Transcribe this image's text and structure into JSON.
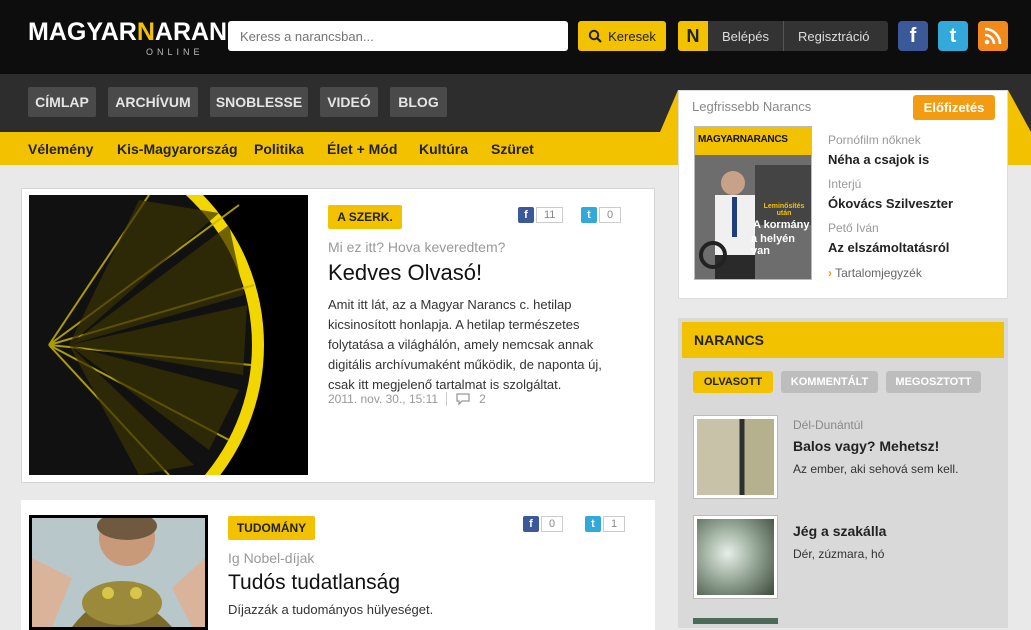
{
  "header": {
    "logo_left": "MAGYAR",
    "logo_n": "N",
    "logo_right": "ARANCS",
    "logo_sub": "ONLINE",
    "search_placeholder": "Keress a narancsban...",
    "search_button": "Keresek",
    "n_icon": "N",
    "login": "Belépés",
    "register": "Regisztráció",
    "social_icons": [
      "facebook-icon",
      "twitter-icon",
      "rss-icon"
    ]
  },
  "nav": {
    "items": [
      "CÍMLAP",
      "ARCHÍVUM",
      "SNOBLESSE",
      "VIDEÓ",
      "BLOG"
    ]
  },
  "subnav": {
    "items": [
      "Vélemény",
      "Kis-Magyarország",
      "Politika",
      "Élet + Mód",
      "Kultúra",
      "Szüret"
    ]
  },
  "articles": [
    {
      "tag": "A SZERK.",
      "fb_count": "11",
      "tw_count": "0",
      "kicker": "Mi ez itt? Hova keveredtem?",
      "title": "Kedves Olvasó!",
      "lead": "Amit itt lát, az a Magyar Narancs c. hetilap kicsinosított honlapja. A hetilap természetes folytatása a világhálón, amely nemcsak annak digitális archívumaként működik, de naponta új, csak itt megjelenő tartalmat is szolgáltat.",
      "date": "2011. nov. 30., 15:11",
      "comments": "2"
    },
    {
      "tag": "TUDOMÁNY",
      "fb_count": "0",
      "tw_count": "1",
      "kicker": "Ig Nobel-díjak",
      "title": "Tudós tudatlanság",
      "lead": "Díjazzák a tudományos hülyeséget."
    }
  ],
  "sidebar": {
    "label": "Legfrissebb Narancs",
    "subscribe": "Előfizetés",
    "cover": {
      "logo": "MAGYARNARANCS",
      "headline_small": "Leminősítés után",
      "headline_1": "A kormány",
      "headline_2": "a helyén van"
    },
    "toc": [
      {
        "cat": "Pornófilm nőknek",
        "title": "Néha a csajok is"
      },
      {
        "cat": "Interjú",
        "title": "Ókovács Szilveszter"
      },
      {
        "cat": "Pető Iván",
        "title": "Az elszámoltatásról"
      }
    ],
    "toc_link": "Tartalomjegyzék"
  },
  "panel": {
    "title": "NARANCS",
    "tabs": [
      "OLVASOTT",
      "KOMMENTÁLT",
      "MEGOSZTOTT"
    ],
    "items": [
      {
        "cat": "Dél-Dunántúl",
        "title": "Balos vagy? Mehetsz!",
        "desc": "Az ember, aki sehová sem kell."
      },
      {
        "cat": "",
        "title": "Jég a szakálla",
        "desc": "Dér, zúzmara, hó"
      }
    ]
  },
  "colors": {
    "accent": "#f2c200",
    "header_bg": "#0d0d0d",
    "nav_bg": "#2d2d2d",
    "subscribe": "#f39c12"
  }
}
